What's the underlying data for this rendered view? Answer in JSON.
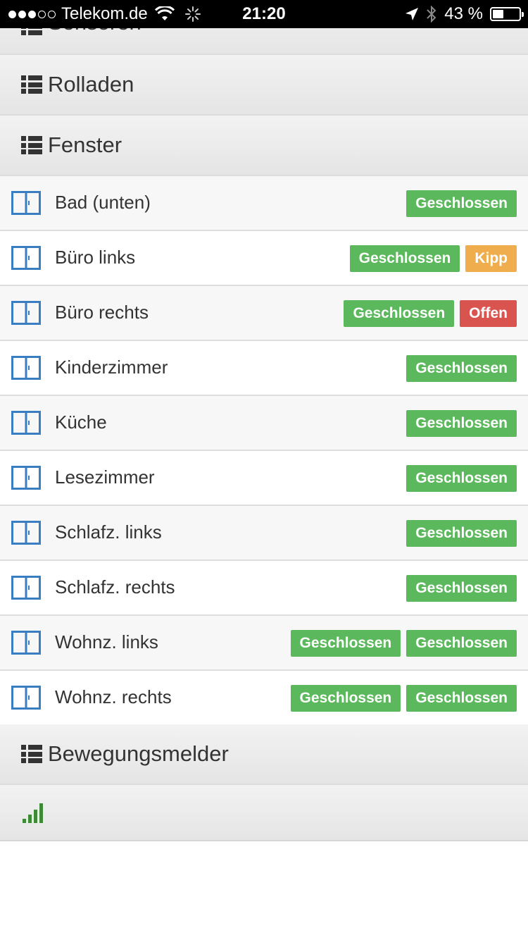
{
  "status_bar": {
    "carrier": "Telekom.de",
    "time": "21:20",
    "battery": "43 %",
    "battery_level": 0.43,
    "signal_dots_filled": 3,
    "signal_dots_total": 5,
    "icons": [
      "wifi-icon",
      "activity-spinner-icon",
      "location-arrow-icon",
      "bluetooth-icon",
      "battery-icon"
    ]
  },
  "sections": {
    "sensoren": "Sensoren",
    "rolladen": "Rolladen",
    "fenster": "Fenster",
    "bewegungsmelder": "Bewegungsmelder"
  },
  "colors": {
    "green": "#5cb85c",
    "orange": "#f0ad4e",
    "red": "#d9534f",
    "window_icon": "#3a7ec2",
    "signal": "#3d8b37"
  },
  "windows": [
    {
      "name": "Bad (unten)",
      "badges": [
        {
          "text": "Geschlossen",
          "color": "green"
        }
      ]
    },
    {
      "name": "Büro links",
      "badges": [
        {
          "text": "Geschlossen",
          "color": "green"
        },
        {
          "text": "Kipp",
          "color": "orange"
        }
      ]
    },
    {
      "name": "Büro rechts",
      "badges": [
        {
          "text": "Geschlossen",
          "color": "green"
        },
        {
          "text": "Offen",
          "color": "red"
        }
      ]
    },
    {
      "name": "Kinderzimmer",
      "badges": [
        {
          "text": "Geschlossen",
          "color": "green"
        }
      ]
    },
    {
      "name": "Küche",
      "badges": [
        {
          "text": "Geschlossen",
          "color": "green"
        }
      ]
    },
    {
      "name": "Lesezimmer",
      "badges": [
        {
          "text": "Geschlossen",
          "color": "green"
        }
      ]
    },
    {
      "name": "Schlafz. links",
      "badges": [
        {
          "text": "Geschlossen",
          "color": "green"
        }
      ]
    },
    {
      "name": "Schlafz. rechts",
      "badges": [
        {
          "text": "Geschlossen",
          "color": "green"
        }
      ]
    },
    {
      "name": "Wohnz. links",
      "badges": [
        {
          "text": "Geschlossen",
          "color": "green"
        },
        {
          "text": "Geschlossen",
          "color": "green"
        }
      ]
    },
    {
      "name": "Wohnz. rechts",
      "badges": [
        {
          "text": "Geschlossen",
          "color": "green"
        },
        {
          "text": "Geschlossen",
          "color": "green"
        }
      ]
    }
  ],
  "bewegungsmelder_icon": "signal-bars-icon"
}
